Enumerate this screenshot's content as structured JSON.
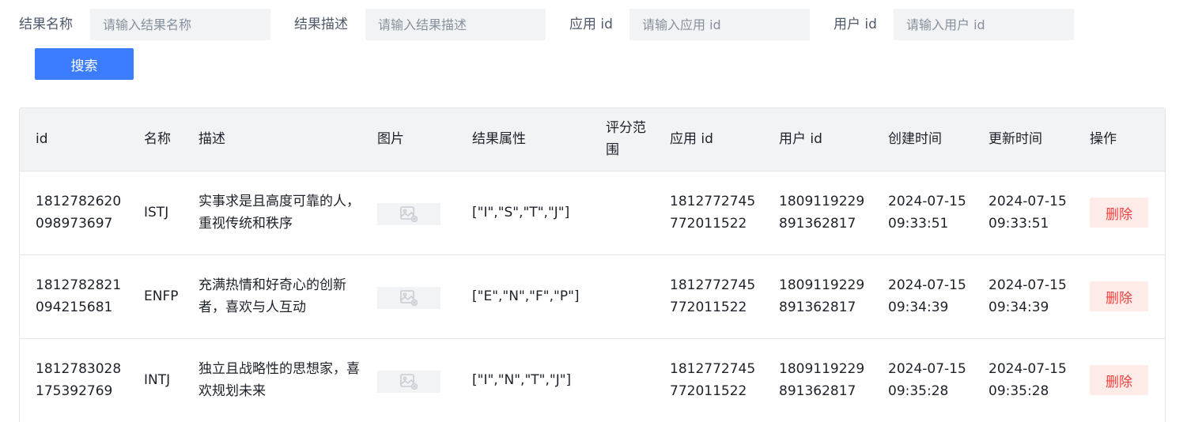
{
  "search": {
    "result_name_label": "结果名称",
    "result_name_placeholder": "请输入结果名称",
    "result_desc_label": "结果描述",
    "result_desc_placeholder": "请输入结果描述",
    "app_id_label": "应用 id",
    "app_id_placeholder": "请输入应用 id",
    "user_id_label": "用户 id",
    "user_id_placeholder": "请输入用户 id",
    "search_button": "搜索"
  },
  "table": {
    "columns": {
      "id": "id",
      "name": "名称",
      "desc": "描述",
      "image": "图片",
      "props": "结果属性",
      "score": "评分范围",
      "app_id": "应用 id",
      "user_id": "用户 id",
      "created": "创建时间",
      "updated": "更新时间",
      "action": "操作"
    },
    "rows": [
      {
        "id": "1812782620098973697",
        "name": "ISTJ",
        "desc": "实事求是且高度可靠的人，重视传统和秩序",
        "props": "[\"I\",\"S\",\"T\",\"J\"]",
        "score": "",
        "app_id": "1812772745772011522",
        "user_id": "1809119229891362817",
        "created": "2024-07-15 09:33:51",
        "updated": "2024-07-15 09:33:51",
        "action": "删除"
      },
      {
        "id": "1812782821094215681",
        "name": "ENFP",
        "desc": "充满热情和好奇心的创新者，喜欢与人互动",
        "props": "[\"E\",\"N\",\"F\",\"P\"]",
        "score": "",
        "app_id": "1812772745772011522",
        "user_id": "1809119229891362817",
        "created": "2024-07-15 09:34:39",
        "updated": "2024-07-15 09:34:39",
        "action": "删除"
      },
      {
        "id": "1812783028175392769",
        "name": "INTJ",
        "desc": "独立且战略性的思想家，喜欢规划未来",
        "props": "[\"I\",\"N\",\"T\",\"J\"]",
        "score": "",
        "app_id": "1812772745772011522",
        "user_id": "1809119229891362817",
        "created": "2024-07-15 09:35:28",
        "updated": "2024-07-15 09:35:28",
        "action": "删除"
      }
    ]
  },
  "icons": {
    "image_placeholder": "broken-image-icon"
  },
  "colors": {
    "primary": "#3c7cff",
    "danger": "#f53f3f",
    "danger_bg": "#ffece8",
    "input_bg": "#f2f3f5",
    "header_bg": "#f2f3f5"
  }
}
